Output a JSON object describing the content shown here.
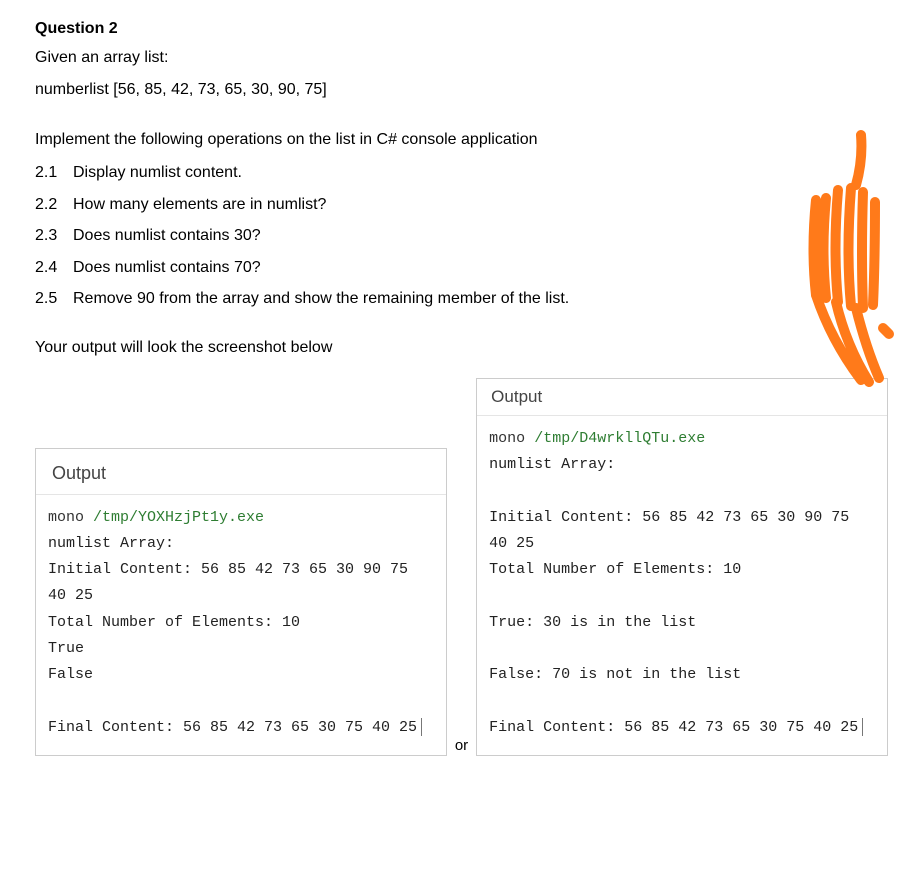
{
  "title": "Question 2",
  "intro1": "Given an array list:",
  "intro2": "numberlist [56, 85, 42, 73, 65, 30, 90, 75]",
  "instr": "Implement the following operations on the list in C# console application",
  "items": [
    {
      "num": "2.1",
      "text": "Display numlist content."
    },
    {
      "num": "2.2",
      "text": "How many elements are in numlist?"
    },
    {
      "num": "2.3",
      "text": "Does numlist contains 30?"
    },
    {
      "num": "2.4",
      "text": "Does numlist contains 70?"
    },
    {
      "num": "2.5",
      "text": "Remove 90 from the array and show the remaining member of the list."
    }
  ],
  "outnote": "Your output will look the screenshot below",
  "or": "or",
  "out1": {
    "header": "Output",
    "cmd": "mono ",
    "path": "/tmp/YOXHzjPt1y.exe",
    "l1": "numlist Array:",
    "l2": "Initial Content: 56 85 42 73 65 30 90 75 40 25",
    "l3": "Total Number of Elements: 10",
    "l4": "True",
    "l5": "False",
    "l6": "Final Content: 56 85 42 73 65 30 75 40 25"
  },
  "out2": {
    "header": "Output",
    "cmd": "mono ",
    "path": "/tmp/D4wrkllQTu.exe",
    "l1": "numlist Array:",
    "l2": "Initial Content: 56 85 42 73 65 30 90 75 40 25",
    "l3": "Total Number of Elements: 10",
    "l4": "True: 30 is in the list",
    "l5": "False: 70 is not in the list",
    "l6": "Final Content: 56 85 42 73 65 30 75 40 25"
  }
}
